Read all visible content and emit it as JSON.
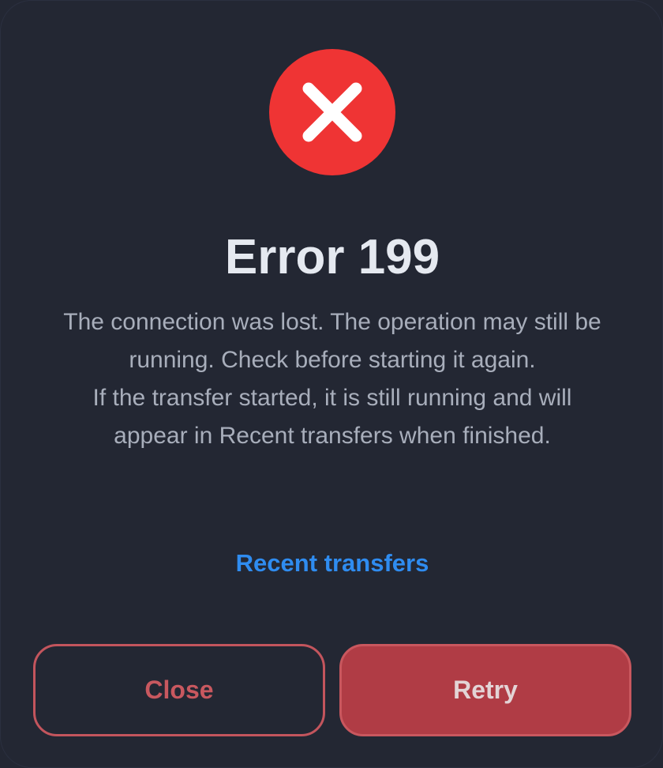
{
  "dialog": {
    "title": "Error 199",
    "message_lines": [
      "The connection was lost. The operation may still be running. Check before starting it again.",
      "If the transfer started, it is still running and will appear in Recent transfers when finished."
    ],
    "link_label": "Recent transfers",
    "close_label": "Close",
    "retry_label": "Retry",
    "icon": "error-x-icon"
  },
  "colors": {
    "background": "#232733",
    "error_red": "#ef3434",
    "link_blue": "#2f8cf0",
    "button_red": "#b03c45"
  }
}
